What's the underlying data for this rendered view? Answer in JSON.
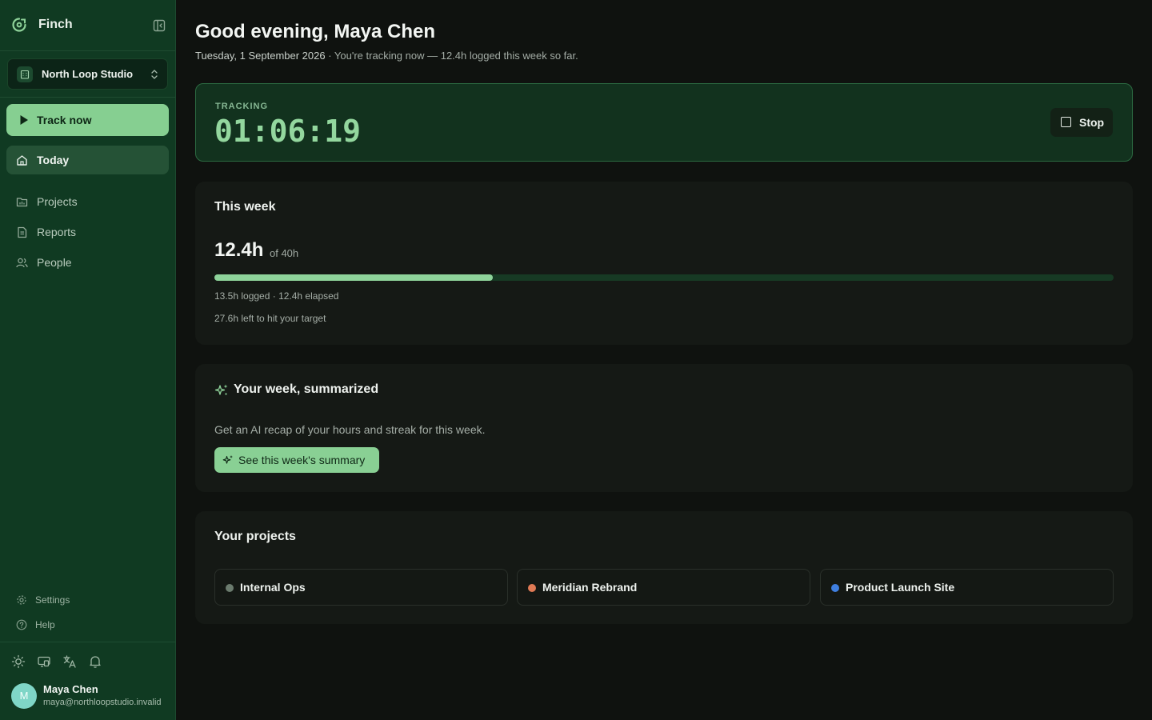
{
  "app": {
    "name": "Finch"
  },
  "workspace": {
    "name": "North Loop Studio"
  },
  "sidebar": {
    "track_label": "Track now",
    "nav": [
      {
        "label": "Today",
        "icon": "home-icon",
        "active": true
      },
      {
        "label": "Projects",
        "icon": "folder-icon",
        "active": false
      },
      {
        "label": "Reports",
        "icon": "document-icon",
        "active": false
      },
      {
        "label": "People",
        "icon": "users-icon",
        "active": false
      }
    ],
    "footer_nav": [
      {
        "label": "Settings",
        "icon": "gear-icon"
      },
      {
        "label": "Help",
        "icon": "help-icon"
      }
    ],
    "tools": [
      "sun-icon",
      "monitor-icon",
      "translate-icon",
      "bell-icon"
    ],
    "user": {
      "initial": "M",
      "name": "Maya Chen",
      "email": "maya@northloopstudio.invalid"
    }
  },
  "header": {
    "greeting": "Good evening, Maya Chen",
    "date": "Tuesday, 1 September 2026",
    "status": " · You're tracking now — 12.4h logged this week so far."
  },
  "tracking": {
    "label": "TRACKING",
    "time": "01:06:19",
    "stop_label": "Stop"
  },
  "week": {
    "title": "This week",
    "hours": "12.4h",
    "target": "of 40h",
    "progress": 0.31,
    "logged_line": "13.5h logged · 12.4h elapsed",
    "left_line": "27.6h left to hit your target"
  },
  "summary": {
    "title": "Your week, summarized",
    "description": "Get an AI recap of your hours and streak for this week.",
    "button_label": "See this week's summary"
  },
  "projects": {
    "title": "Your projects",
    "items": [
      {
        "name": "Internal Ops",
        "color": "#6b7b6e"
      },
      {
        "name": "Meridian Rebrand",
        "color": "#e07a55"
      },
      {
        "name": "Product Launch Site",
        "color": "#3f7fe0"
      }
    ]
  },
  "colors": {
    "accent": "#86cf91",
    "sidebar_bg": "#103a22",
    "page_bg": "#0f120f"
  }
}
